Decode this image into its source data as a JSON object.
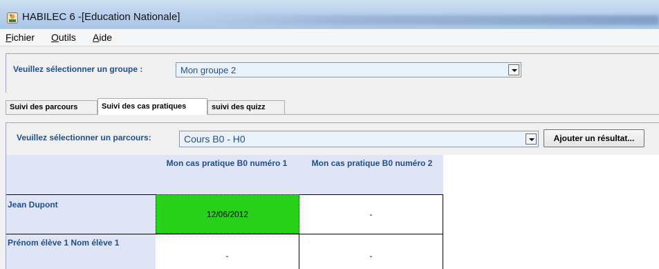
{
  "window": {
    "title": "HABILEC 6 -[Education Nationale]"
  },
  "menu": [
    {
      "label": "Fichier"
    },
    {
      "label": "Outils"
    },
    {
      "label": "Aide"
    }
  ],
  "group": {
    "label": "Veuillez sélectionner un groupe :",
    "selected": "Mon groupe 2"
  },
  "tabs": [
    {
      "label": "Suivi des parcours"
    },
    {
      "label": "Suivi des cas pratiques",
      "active": true
    },
    {
      "label": "suivi des quizz"
    }
  ],
  "parcours": {
    "label": "Veuillez sélectionner un parcours:",
    "selected": "Cours B0 - H0",
    "add_button": "Ajouter un résultat..."
  },
  "grid": {
    "columns": [
      "Mon cas pratique B0 numéro 1",
      "Mon cas pratique B0 numéro 2"
    ],
    "rows": [
      {
        "name": "Jean Dupont",
        "cells": [
          "12/06/2012",
          "-"
        ]
      },
      {
        "name": "Prénom élève 1 Nom élève 1",
        "cells": [
          "-",
          "-"
        ]
      }
    ]
  },
  "colors": {
    "label_blue": "#1f4e8c",
    "header_bg": "#dfe4f7",
    "completed_cell": "#29d21a"
  },
  "icons": {
    "app": "habilec-app-icon"
  }
}
